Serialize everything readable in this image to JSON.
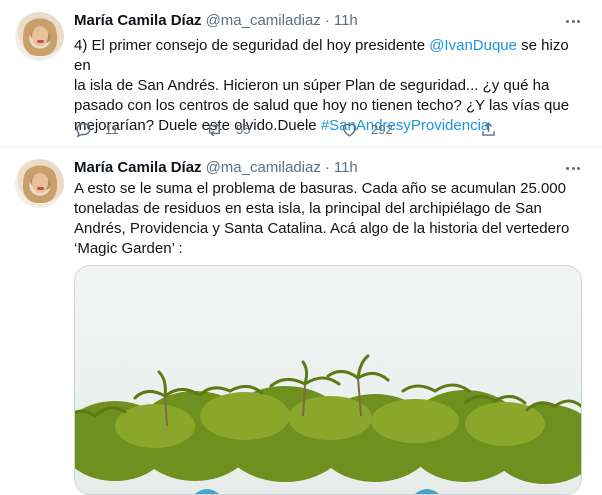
{
  "tweets": [
    {
      "author": {
        "name": "María Camila Díaz",
        "handle": "@ma_camiladiaz",
        "time": "11h"
      },
      "lines": [
        [
          {
            "t": "4) El primer consejo de seguridad del hoy presidente "
          },
          {
            "t": "@IvanDuque",
            "link": true
          },
          {
            "t": " se hizo en"
          }
        ],
        [
          {
            "t": "la isla de San Andrés. Hicieron un súper Plan de seguridad... ¿y qué ha"
          }
        ],
        [
          {
            "t": "pasado con los centros de salud que hoy no tienen techo? ¿Y las vías que"
          }
        ],
        [
          {
            "t": "mejorarían? Duele este olvido.Duele "
          },
          {
            "t": "#SanAndresyProvidencia",
            "link": true
          }
        ]
      ],
      "stats": {
        "replies": "11",
        "retweets": "55",
        "likes": "292"
      }
    },
    {
      "author": {
        "name": "María Camila Díaz",
        "handle": "@ma_camiladiaz",
        "time": "11h"
      },
      "lines": [
        [
          {
            "t": "A esto se le suma el problema de basuras. Cada año se acumulan 25.000"
          }
        ],
        [
          {
            "t": "toneladas de residuos en esta isla, la principal del archipiélago de San"
          }
        ],
        [
          {
            "t": "Andrés, Providencia y Santa Catalina. Acá algo de la historia del vertedero"
          }
        ],
        [
          {
            "t": "‘Magic Garden’ :"
          }
        ]
      ],
      "media": {
        "kind": "photo",
        "subject": "palm trees"
      }
    }
  ],
  "icons": {
    "reply": "comment-icon",
    "retweet": "retweet-icon",
    "like": "heart-icon",
    "share": "share-icon",
    "more": "more-dots-icon"
  },
  "colors": {
    "link": "#1b95e0",
    "muted": "#5b7083",
    "text": "#0f1419",
    "divider": "#e6ecf0"
  }
}
